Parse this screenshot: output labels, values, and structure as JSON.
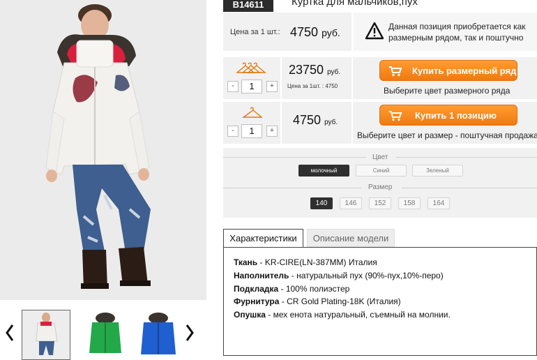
{
  "product": {
    "sku": "B14611",
    "title": "Куртка для мальчиков,пух"
  },
  "pricing": {
    "unit_label": "Цена за 1 шт.:",
    "unit_price": "4750",
    "currency": "руб.",
    "note": "Данная позиция приобретается как размерным рядом, так и поштучно"
  },
  "set_row": {
    "quantity": "1",
    "price": "23750",
    "currency": "руб.",
    "per_unit": "Цена за 1шт. : 4750",
    "button_label": "Купить размерный ряд",
    "hint": "Выберите цвет размерного ряда"
  },
  "single_row": {
    "quantity": "1",
    "price": "4750",
    "currency": "руб.",
    "button_label": "Купить 1 позицию",
    "hint": "Выберите цвет и размер - поштучная продажа"
  },
  "stepper": {
    "minus": "-",
    "plus": "+"
  },
  "options": {
    "color_heading": "Цвет",
    "colors": [
      "молочный",
      "Синий",
      "Зеленый"
    ],
    "selected_color": "молочный",
    "size_heading": "Размер",
    "sizes": [
      "140",
      "146",
      "152",
      "158",
      "164"
    ],
    "selected_size": "140"
  },
  "tabs": {
    "characteristics": "Характеристики",
    "description": "Описание модели"
  },
  "specs": [
    {
      "label": "Ткань",
      "value": " - KR-CIRE(LN-387MM) Италия"
    },
    {
      "label": "Наполнитель",
      "value": " - натуральный пух (90%-пух,10%-перо)"
    },
    {
      "label": "Подкладка",
      "value": " - 100% полиэстер"
    },
    {
      "label": "Фурнитура",
      "value": " - CR Gold Plating-18K (Италия)"
    },
    {
      "label": "Опушка",
      "value": " - мех енота натуральный, съемный на молнии."
    }
  ],
  "colors": {
    "accent": "#f07a10",
    "dark": "#2b2b2b",
    "panel": "#f1f1f1"
  },
  "icons": {
    "warning": "warning-triangle-icon",
    "cart": "shopping-cart-icon",
    "hanger": "hanger-icon",
    "prev": "chevron-left-icon",
    "next": "chevron-right-icon"
  }
}
